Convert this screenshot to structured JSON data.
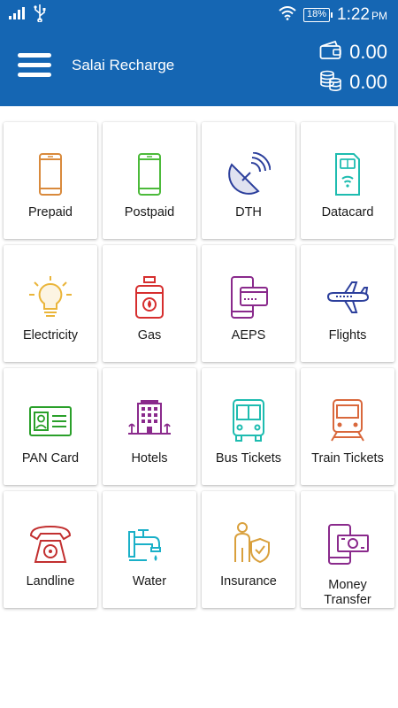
{
  "status_bar": {
    "battery": "18%",
    "time": "1:22",
    "meridiem": "PM"
  },
  "header": {
    "title": "Salai Recharge",
    "wallet_balance": "0.00",
    "coin_balance": "0.00"
  },
  "services": [
    {
      "label": "Prepaid",
      "icon": "mobile-phone-icon",
      "color": "#d98a3c"
    },
    {
      "label": "Postpaid",
      "icon": "mobile-phone-icon",
      "color": "#4cba3a"
    },
    {
      "label": "DTH",
      "icon": "satellite-dish-icon",
      "color": "#2c3f9c"
    },
    {
      "label": "Datacard",
      "icon": "sim-card-icon",
      "color": "#1ebcb0"
    },
    {
      "label": "Electricity",
      "icon": "light-bulb-icon",
      "color": "#eab53a"
    },
    {
      "label": "Gas",
      "icon": "gas-cylinder-icon",
      "color": "#d62e2e"
    },
    {
      "label": "AEPS",
      "icon": "card-on-phone-icon",
      "color": "#8a2a8c"
    },
    {
      "label": "Flights",
      "icon": "airplane-icon",
      "color": "#2c3f9c"
    },
    {
      "label": "PAN Card",
      "icon": "id-card-icon",
      "color": "#2aa02a"
    },
    {
      "label": "Hotels",
      "icon": "hotel-building-icon",
      "color": "#8a2a8c"
    },
    {
      "label": "Bus Tickets",
      "icon": "bus-icon",
      "color": "#1ebcb0"
    },
    {
      "label": "Train Tickets",
      "icon": "train-icon",
      "color": "#d9683c"
    },
    {
      "label": "Landline",
      "icon": "telephone-icon",
      "color": "#c23030"
    },
    {
      "label": "Water",
      "icon": "water-tap-icon",
      "color": "#1ab0c8"
    },
    {
      "label": "Insurance",
      "icon": "insurance-person-icon",
      "color": "#d9a03c"
    },
    {
      "label": "Money Transfer",
      "icon": "money-transfer-icon",
      "color": "#8a2a8c"
    }
  ]
}
